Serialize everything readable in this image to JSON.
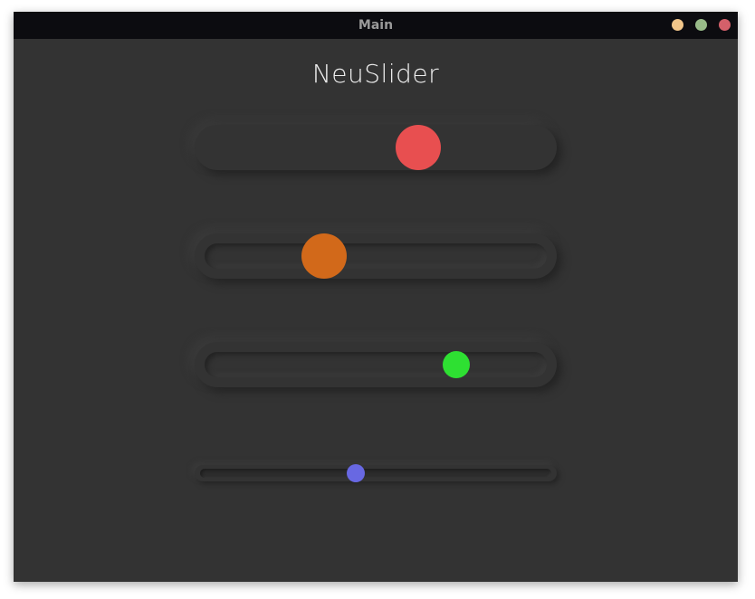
{
  "window": {
    "title": "Main",
    "controls": [
      "minimize-button",
      "maximize-button",
      "close-button"
    ]
  },
  "app": {
    "title": "NeuSlider"
  },
  "sliders": [
    {
      "name": "slider-red",
      "style": "raised",
      "value": 0.64,
      "knob_color": "#e84f50"
    },
    {
      "name": "slider-orange",
      "style": "ring",
      "value": 0.33,
      "knob_color": "#d2691a"
    },
    {
      "name": "slider-green",
      "style": "ring",
      "value": 0.75,
      "knob_color": "#2ee032"
    },
    {
      "name": "slider-blue",
      "style": "thin",
      "value": 0.44,
      "knob_color": "#6868e2"
    }
  ],
  "colors": {
    "background": "#333333",
    "titlebar": "#0c0c10",
    "title_text": "#eeeeee"
  }
}
